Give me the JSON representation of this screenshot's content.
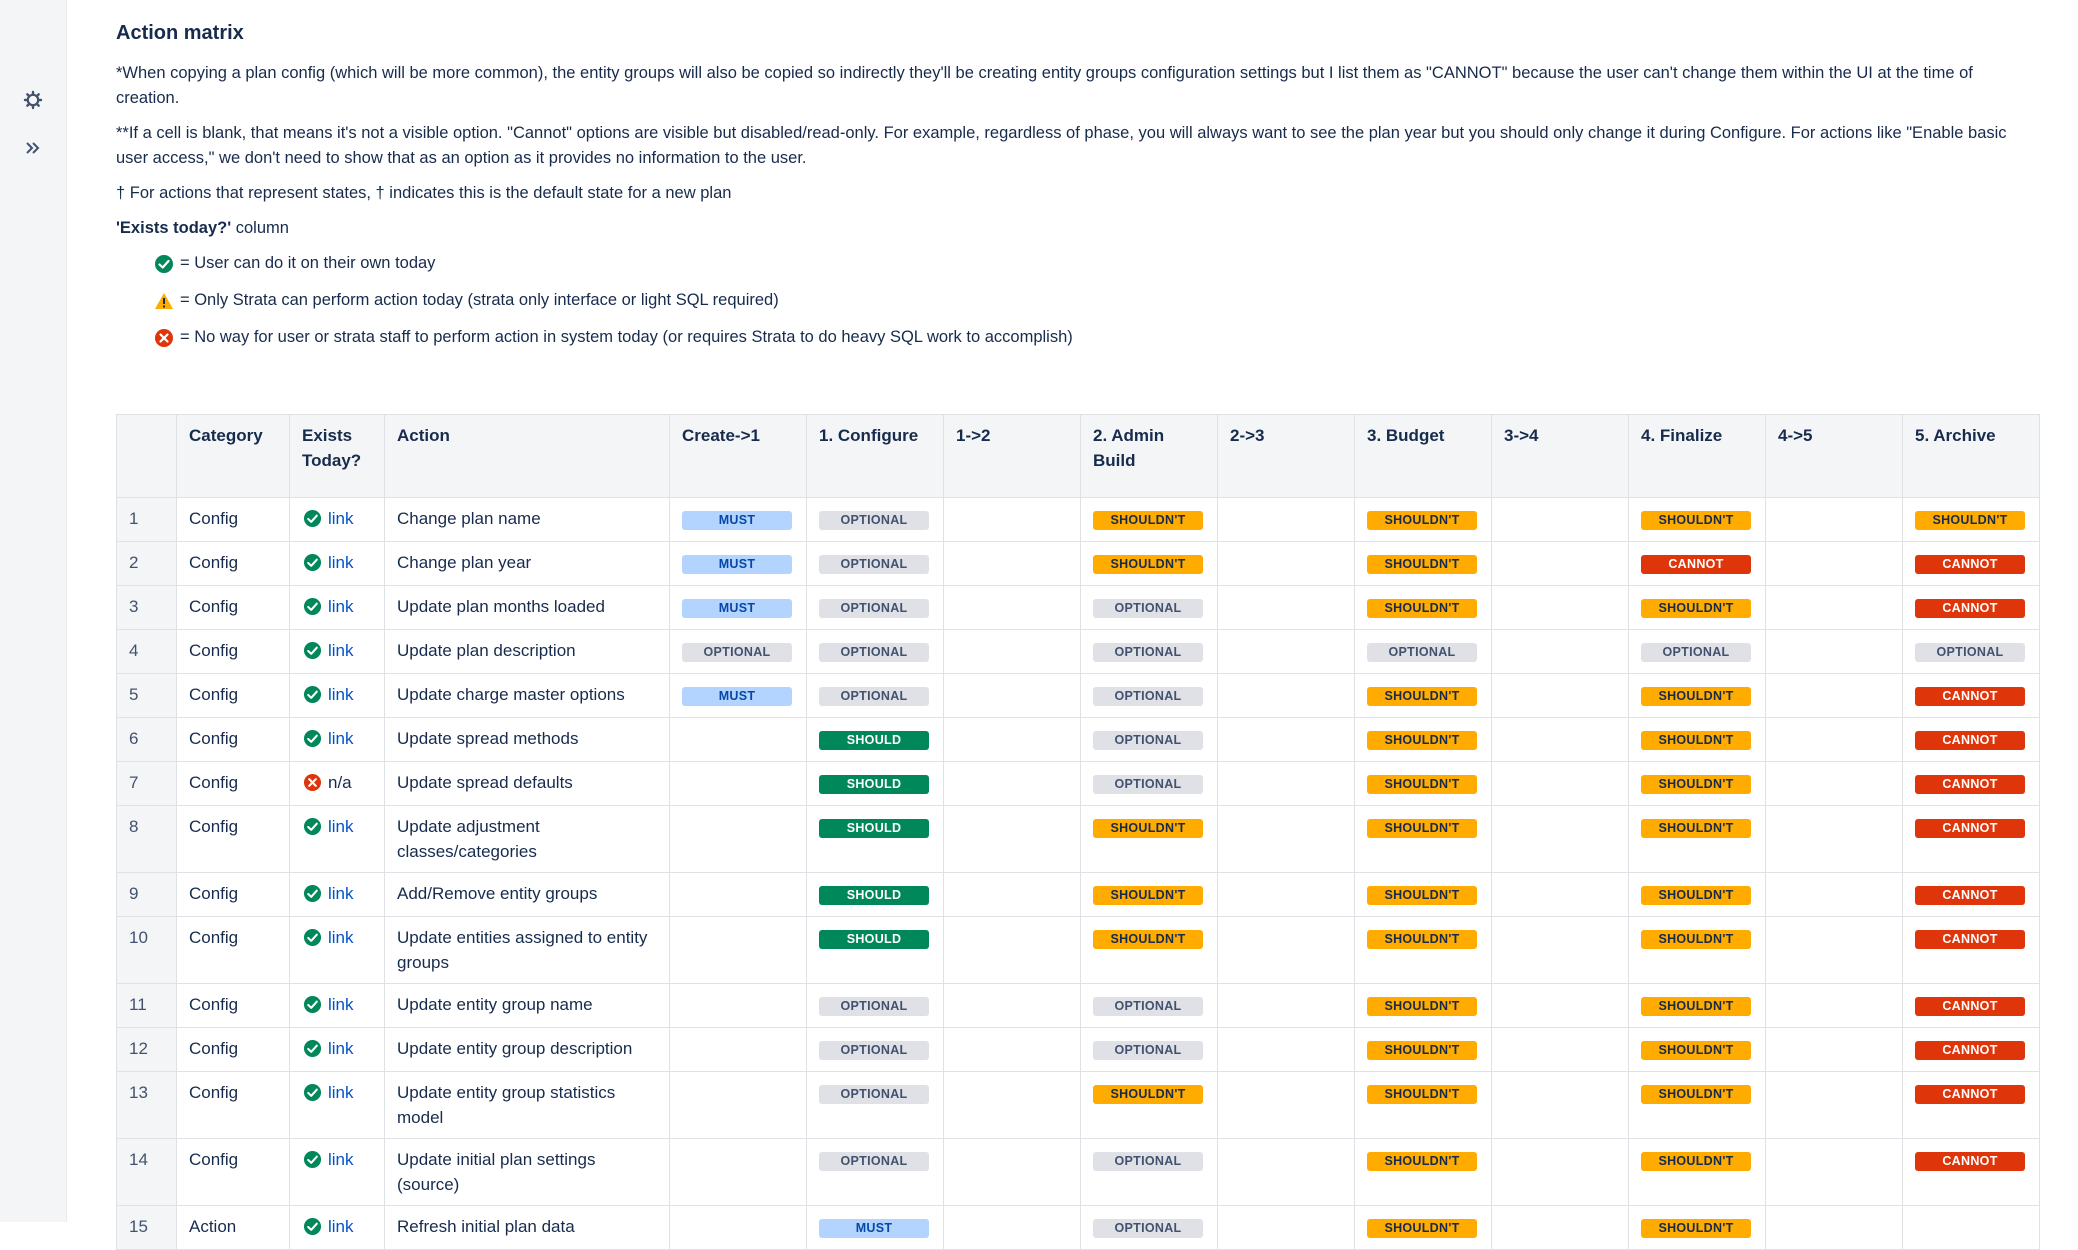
{
  "sidebar": {
    "icons": [
      "gear-icon",
      "double-chevron-right-icon"
    ]
  },
  "page": {
    "title": "Action matrix",
    "note1": "*When copying a plan config (which will be more common), the entity groups will also be copied so indirectly they'll be creating entity groups configuration settings but I list them as \"CANNOT\" because the user can't change them within the UI at the time of creation.",
    "note2": "**If a cell is blank, that means it's not a visible option. \"Cannot\" options are visible but disabled/read-only. For example, regardless of phase, you will always want to see the plan year but you should only change it during Configure. For actions like \"Enable basic user access,\" we don't need to show that as an option as it provides no information to the user.",
    "note3": "† For actions that represent states, † indicates this is the default state for a new plan",
    "exists_heading_bold": "'Exists today?'",
    "exists_heading_rest": " column",
    "legend": [
      {
        "icon": "check-circle-icon",
        "text": "= User can do it on their own today"
      },
      {
        "icon": "warning-icon",
        "text": "= Only Strata can perform action today (strata only interface or light SQL required)"
      },
      {
        "icon": "error-circle-icon",
        "text": "= No way for user or strata staff to perform action in system today (or requires Strata to do heavy SQL work to accomplish)"
      }
    ]
  },
  "colors": {
    "must": "#b3d4ff",
    "optional": "#dfe1e6",
    "should": "#00875a",
    "shouldnt": "#ffab00",
    "cannot": "#de350b"
  },
  "labels": {
    "MUST": "MUST",
    "OPTIONAL": "OPTIONAL",
    "SHOULD": "SHOULD",
    "SHOULDNT": "SHOULDN'T",
    "CANNOT": "CANNOT"
  },
  "table": {
    "headers": [
      "",
      "Category",
      "Exists Today?",
      "Action",
      "Create->1",
      "1. Configure",
      "1->2",
      "2. Admin Build",
      "2->3",
      "3. Budget",
      "3->4",
      "4. Finalize",
      "4->5",
      "5. Archive"
    ],
    "rows": [
      {
        "n": "1",
        "category": "Config",
        "exists": "check",
        "link": "link",
        "action": "Change plan name",
        "cells": [
          "MUST",
          "OPTIONAL",
          "",
          "SHOULDNT",
          "",
          "SHOULDNT",
          "",
          "SHOULDNT",
          "",
          "SHOULDNT"
        ]
      },
      {
        "n": "2",
        "category": "Config",
        "exists": "check",
        "link": "link",
        "action": "Change plan year",
        "cells": [
          "MUST",
          "OPTIONAL",
          "",
          "SHOULDNT",
          "",
          "SHOULDNT",
          "",
          "CANNOT",
          "",
          "CANNOT"
        ]
      },
      {
        "n": "3",
        "category": "Config",
        "exists": "check",
        "link": "link",
        "action": "Update plan months loaded",
        "cells": [
          "MUST",
          "OPTIONAL",
          "",
          "OPTIONAL",
          "",
          "SHOULDNT",
          "",
          "SHOULDNT",
          "",
          "CANNOT"
        ]
      },
      {
        "n": "4",
        "category": "Config",
        "exists": "check",
        "link": "link",
        "action": "Update plan description",
        "cells": [
          "OPTIONAL",
          "OPTIONAL",
          "",
          "OPTIONAL",
          "",
          "OPTIONAL",
          "",
          "OPTIONAL",
          "",
          "OPTIONAL"
        ]
      },
      {
        "n": "5",
        "category": "Config",
        "exists": "check",
        "link": "link",
        "action": "Update charge master options",
        "cells": [
          "MUST",
          "OPTIONAL",
          "",
          "OPTIONAL",
          "",
          "SHOULDNT",
          "",
          "SHOULDNT",
          "",
          "CANNOT"
        ]
      },
      {
        "n": "6",
        "category": "Config",
        "exists": "check",
        "link": "link",
        "action": "Update spread methods",
        "cells": [
          "",
          "SHOULD",
          "",
          "OPTIONAL",
          "",
          "SHOULDNT",
          "",
          "SHOULDNT",
          "",
          "CANNOT"
        ]
      },
      {
        "n": "7",
        "category": "Config",
        "exists": "error",
        "link": "n/a",
        "action": "Update spread defaults",
        "cells": [
          "",
          "SHOULD",
          "",
          "OPTIONAL",
          "",
          "SHOULDNT",
          "",
          "SHOULDNT",
          "",
          "CANNOT"
        ]
      },
      {
        "n": "8",
        "category": "Config",
        "exists": "check",
        "link": "link",
        "action": "Update adjustment classes/categories",
        "cells": [
          "",
          "SHOULD",
          "",
          "SHOULDNT",
          "",
          "SHOULDNT",
          "",
          "SHOULDNT",
          "",
          "CANNOT"
        ]
      },
      {
        "n": "9",
        "category": "Config",
        "exists": "check",
        "link": "link",
        "action": "Add/Remove entity groups",
        "cells": [
          "",
          "SHOULD",
          "",
          "SHOULDNT",
          "",
          "SHOULDNT",
          "",
          "SHOULDNT",
          "",
          "CANNOT"
        ]
      },
      {
        "n": "10",
        "category": "Config",
        "exists": "check",
        "link": "link",
        "action": "Update entities assigned to entity groups",
        "cells": [
          "",
          "SHOULD",
          "",
          "SHOULDNT",
          "",
          "SHOULDNT",
          "",
          "SHOULDNT",
          "",
          "CANNOT"
        ]
      },
      {
        "n": "11",
        "category": "Config",
        "exists": "check",
        "link": "link",
        "action": "Update entity group name",
        "cells": [
          "",
          "OPTIONAL",
          "",
          "OPTIONAL",
          "",
          "SHOULDNT",
          "",
          "SHOULDNT",
          "",
          "CANNOT"
        ]
      },
      {
        "n": "12",
        "category": "Config",
        "exists": "check",
        "link": "link",
        "action": "Update entity group description",
        "cells": [
          "",
          "OPTIONAL",
          "",
          "OPTIONAL",
          "",
          "SHOULDNT",
          "",
          "SHOULDNT",
          "",
          "CANNOT"
        ]
      },
      {
        "n": "13",
        "category": "Config",
        "exists": "check",
        "link": "link",
        "action": "Update entity group statistics model",
        "cells": [
          "",
          "OPTIONAL",
          "",
          "SHOULDNT",
          "",
          "SHOULDNT",
          "",
          "SHOULDNT",
          "",
          "CANNOT"
        ]
      },
      {
        "n": "14",
        "category": "Config",
        "exists": "check",
        "link": "link",
        "action": "Update initial plan settings (source)",
        "cells": [
          "",
          "OPTIONAL",
          "",
          "OPTIONAL",
          "",
          "SHOULDNT",
          "",
          "SHOULDNT",
          "",
          "CANNOT"
        ]
      },
      {
        "n": "15",
        "category": "Action",
        "exists": "check",
        "link": "link",
        "action": "Refresh initial plan data",
        "cells": [
          "",
          "MUST",
          "",
          "OPTIONAL",
          "",
          "SHOULDNT",
          "",
          "SHOULDNT",
          "",
          ""
        ]
      }
    ]
  }
}
